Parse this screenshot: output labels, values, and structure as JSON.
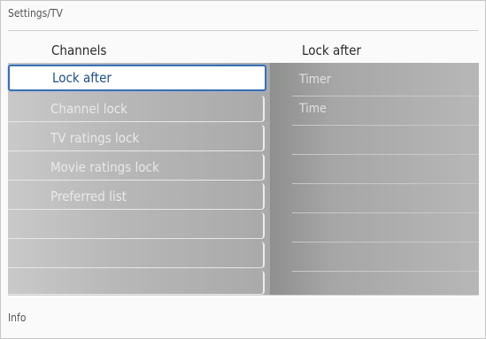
{
  "breadcrumb": "Settings/TV",
  "left_header": "Channels",
  "right_header": "Lock after",
  "menu": {
    "selected_index": 0,
    "items": [
      "Lock after",
      "Channel lock",
      "TV ratings lock",
      "Movie ratings lock",
      "Preferred list",
      "",
      "",
      ""
    ]
  },
  "submenu": {
    "items": [
      "Timer",
      "Time"
    ]
  },
  "footer": {
    "info_label": "Info"
  }
}
